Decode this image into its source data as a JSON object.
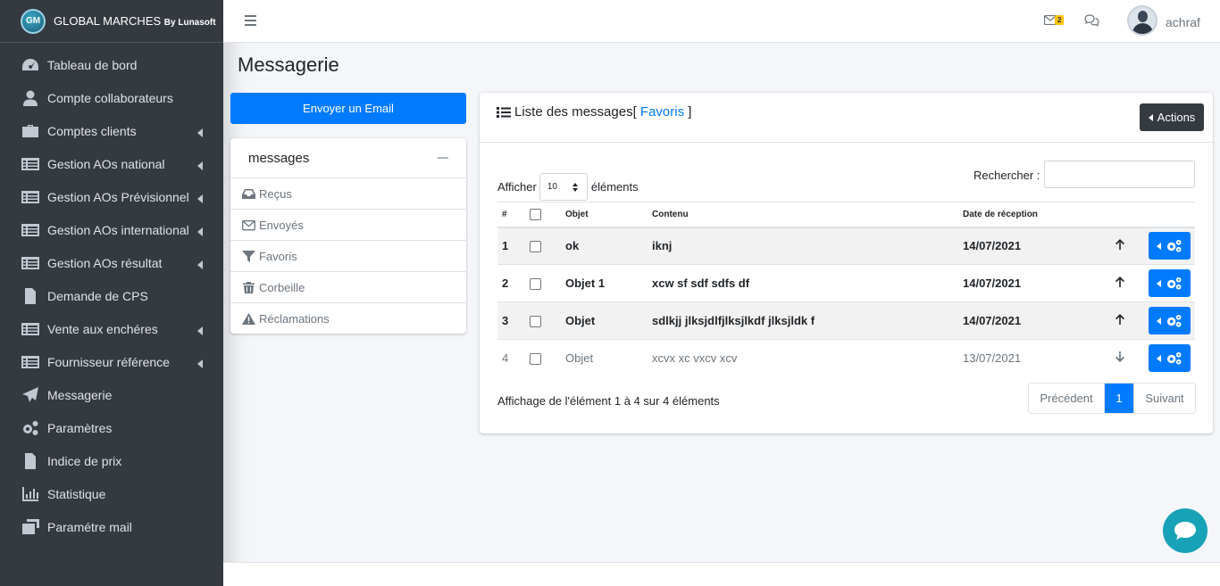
{
  "brand": {
    "logo": "GM",
    "name": "GLOBAL MARCHES",
    "by": "By Lunasoft"
  },
  "sidebar": {
    "items": [
      {
        "label": "Tableau de bord",
        "icon": "dashboard-icon",
        "chevron": false
      },
      {
        "label": "Compte collaborateurs",
        "icon": "user-icon",
        "chevron": false
      },
      {
        "label": "Comptes clients",
        "icon": "briefcase-icon",
        "chevron": true
      },
      {
        "label": "Gestion AOs national",
        "icon": "list-card-icon",
        "chevron": true
      },
      {
        "label": "Gestion AOs Prévisionnel",
        "icon": "list-card-icon",
        "chevron": true
      },
      {
        "label": "Gestion AOs international",
        "icon": "list-card-icon",
        "chevron": true
      },
      {
        "label": "Gestion AOs résultat",
        "icon": "list-card-icon",
        "chevron": true
      },
      {
        "label": "Demande de CPS",
        "icon": "file-icon",
        "chevron": false
      },
      {
        "label": "Vente aux enchéres",
        "icon": "list-card-icon",
        "chevron": true
      },
      {
        "label": "Fournisseur référence",
        "icon": "list-card-icon",
        "chevron": true
      },
      {
        "label": "Messagerie",
        "icon": "paper-plane-icon",
        "chevron": false
      },
      {
        "label": "Paramètres",
        "icon": "cogs-icon",
        "chevron": false
      },
      {
        "label": "Indice de prix",
        "icon": "file-icon",
        "chevron": false
      },
      {
        "label": "Statistique",
        "icon": "bar-chart-icon",
        "chevron": false
      },
      {
        "label": "Paramétre mail",
        "icon": "mail-bulk-icon",
        "chevron": false
      }
    ]
  },
  "topbar": {
    "mail_count": "2",
    "username": "achraf"
  },
  "page": {
    "title": "Messagerie"
  },
  "compose": {
    "label": "Envoyer un Email"
  },
  "folders": {
    "title": "messages",
    "items": [
      {
        "label": "Reçus",
        "icon": "inbox-icon"
      },
      {
        "label": "Envoyés",
        "icon": "envelope-icon"
      },
      {
        "label": "Favoris",
        "icon": "filter-icon"
      },
      {
        "label": "Corbeille",
        "icon": "trash-icon"
      },
      {
        "label": "Réclamations",
        "icon": "warning-icon"
      }
    ]
  },
  "list": {
    "title": "Liste des messages",
    "filter_prefix": "[",
    "filter": " Favoris ",
    "filter_suffix": "]",
    "actions_label": "Actions",
    "show_label": "Afficher",
    "page_size": "10",
    "elements_label": "éléments",
    "search_label": "Rechercher :",
    "search_value": "",
    "columns": [
      "#",
      "",
      "Objet",
      "Contenu",
      "Date de réception"
    ],
    "rows": [
      {
        "num": "1",
        "objet": "ok",
        "contenu": "iknj",
        "date": "14/07/2021",
        "unread": true,
        "direction": "up"
      },
      {
        "num": "2",
        "objet": "Objet 1",
        "contenu": "xcw sf sdf sdfs df",
        "date": "14/07/2021",
        "unread": true,
        "direction": "up"
      },
      {
        "num": "3",
        "objet": "Objet",
        "contenu": "sdlkjj jlksjdlfjlksjlkdf jlksjldk f",
        "date": "14/07/2021",
        "unread": true,
        "direction": "up"
      },
      {
        "num": "4",
        "objet": "Objet",
        "contenu": "xcvx xc vxcv xcv",
        "date": "13/07/2021",
        "unread": false,
        "direction": "down"
      }
    ],
    "info": "Affichage de l'élément 1 à 4 sur 4 éléments",
    "pager": {
      "prev": "Précédent",
      "current": "1",
      "next": "Suivant"
    }
  },
  "colors": {
    "sidebar": "#343a40",
    "primary": "#007bff",
    "chat": "#17a2b8",
    "badge": "#ffc107"
  }
}
